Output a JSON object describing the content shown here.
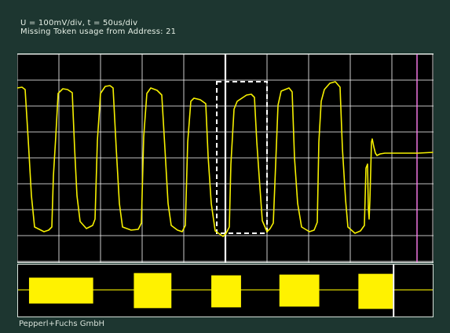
{
  "header": {
    "line1": "U = 100mV/div, t = 50us/div",
    "line2": "Missing Token usage from Address: 21"
  },
  "footer": {
    "brand": "Pepperl+Fuchs GmbH"
  },
  "colors": {
    "background": "#1d3630",
    "screen": "#000000",
    "grid": "#ffffff",
    "trace": "#f6f000",
    "burst": "#fff200",
    "marker_magenta": "#ff7ef0",
    "selection_box": "#ffffff"
  },
  "scope": {
    "main_channel": "voltage",
    "burst_channel": "activity",
    "selection_marker": "dashed-box"
  }
}
